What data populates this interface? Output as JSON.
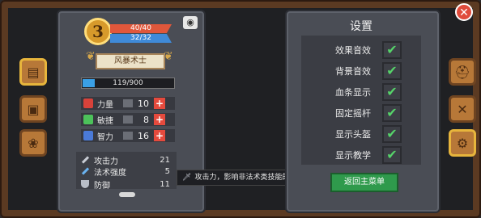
{
  "character": {
    "level": "3",
    "hp": "40/40",
    "mp": "32/32",
    "class_name": "风暴术士",
    "xp_text": "119/900",
    "xp_fraction": 0.13
  },
  "attributes": [
    {
      "label": "力量",
      "value": "10",
      "color": "#d8423a"
    },
    {
      "label": "敏捷",
      "value": "8",
      "color": "#4cc25a"
    },
    {
      "label": "智力",
      "value": "16",
      "color": "#4a7ad8"
    }
  ],
  "stats": [
    {
      "label": "攻击力",
      "value": "21"
    },
    {
      "label": "法术强度",
      "value": "5"
    },
    {
      "label": "防御",
      "value": "11"
    }
  ],
  "tooltip": "攻击力，影响非法术类技能的伤害",
  "settings": {
    "title": "设置",
    "options": [
      {
        "label": "效果音效",
        "checked": true
      },
      {
        "label": "背景音效",
        "checked": true
      },
      {
        "label": "血条显示",
        "checked": true
      },
      {
        "label": "固定摇杆",
        "checked": true
      },
      {
        "label": "显示头盔",
        "checked": true
      },
      {
        "label": "显示教学",
        "checked": true
      }
    ],
    "back_label": "返回主菜单"
  },
  "icons": {
    "camera": "camera-icon",
    "close": "close-icon",
    "left_tabs": [
      "book-icon",
      "chest-icon",
      "paw-icon"
    ],
    "right_tabs": [
      "helmet-icon",
      "crossed-swords-icon",
      "gear-icon"
    ]
  }
}
